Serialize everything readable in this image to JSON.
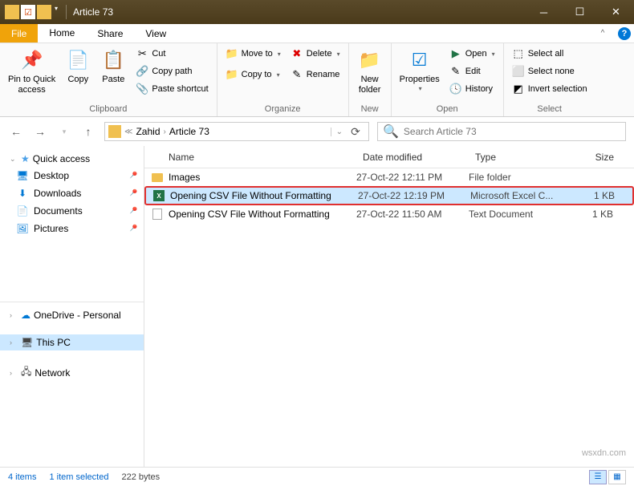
{
  "titlebar": {
    "title": "Article 73"
  },
  "tabs": {
    "file": "File",
    "home": "Home",
    "share": "Share",
    "view": "View"
  },
  "ribbon": {
    "clipboard": {
      "label": "Clipboard",
      "pin": "Pin to Quick\naccess",
      "copy": "Copy",
      "paste": "Paste",
      "cut": "Cut",
      "copy_path": "Copy path",
      "paste_shortcut": "Paste shortcut"
    },
    "organize": {
      "label": "Organize",
      "move_to": "Move to",
      "copy_to": "Copy to",
      "delete": "Delete",
      "rename": "Rename"
    },
    "new": {
      "label": "New",
      "new_folder": "New\nfolder"
    },
    "open": {
      "label": "Open",
      "properties": "Properties",
      "open": "Open",
      "edit": "Edit",
      "history": "History"
    },
    "select": {
      "label": "Select",
      "select_all": "Select all",
      "select_none": "Select none",
      "invert": "Invert selection"
    }
  },
  "path": {
    "seg1": "Zahid",
    "seg2": "Article 73"
  },
  "search": {
    "placeholder": "Search Article 73"
  },
  "nav": {
    "quick_access": "Quick access",
    "desktop": "Desktop",
    "downloads": "Downloads",
    "documents": "Documents",
    "pictures": "Pictures",
    "onedrive": "OneDrive - Personal",
    "this_pc": "This PC",
    "network": "Network"
  },
  "columns": {
    "name": "Name",
    "date": "Date modified",
    "type": "Type",
    "size": "Size"
  },
  "files": [
    {
      "name": "Images",
      "date": "27-Oct-22 12:11 PM",
      "type": "File folder",
      "size": "",
      "icon": "folder"
    },
    {
      "name": "Opening CSV File Without Formatting",
      "date": "27-Oct-22 12:19 PM",
      "type": "Microsoft Excel C...",
      "size": "1 KB",
      "icon": "excel",
      "selected": true
    },
    {
      "name": "Opening CSV File Without Formatting",
      "date": "27-Oct-22 11:50 AM",
      "type": "Text Document",
      "size": "1 KB",
      "icon": "txt"
    }
  ],
  "status": {
    "items": "4 items",
    "selected": "1 item selected",
    "size": "222 bytes"
  },
  "watermark": "wsxdn.com"
}
